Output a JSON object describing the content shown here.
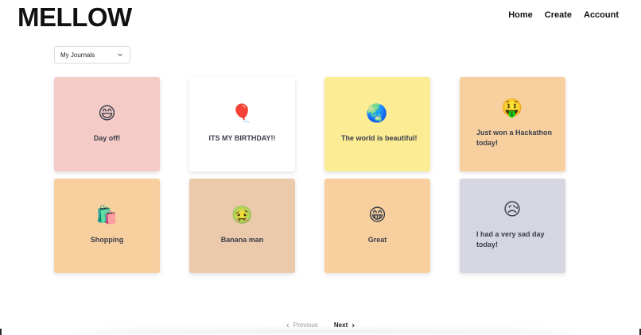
{
  "brand": {
    "logo": "MELLOW"
  },
  "nav": {
    "home": "Home",
    "create": "Create",
    "account": "Account"
  },
  "filter": {
    "selected": "My Journals"
  },
  "cards": [
    {
      "emoji": "😄",
      "title": "Day off!",
      "bg": "#f5cbc7",
      "align": "center"
    },
    {
      "emoji": "🎈",
      "title": "ITS MY BIRTHDAY!!",
      "bg": "#ffffff",
      "align": "center"
    },
    {
      "emoji": "🌏",
      "title": "The world is beautiful!",
      "bg": "#fcec94",
      "align": "left"
    },
    {
      "emoji": "🤑",
      "title": "Just won a Hackathon today!",
      "bg": "#f8cf9e",
      "align": "left"
    },
    {
      "emoji": "🛍️",
      "title": "Shopping",
      "bg": "#f8cf9e",
      "align": "center"
    },
    {
      "emoji": "🤢",
      "title": "Banana man",
      "bg": "#ebc9ab",
      "align": "center"
    },
    {
      "emoji": "😁",
      "title": "Great",
      "bg": "#f8cf9e",
      "align": "center"
    },
    {
      "emoji": "😥",
      "title": "I had a very sad day today!",
      "bg": "#d6d6e2",
      "align": "left"
    }
  ],
  "pagination": {
    "previous": "Previous",
    "next": "Next"
  }
}
